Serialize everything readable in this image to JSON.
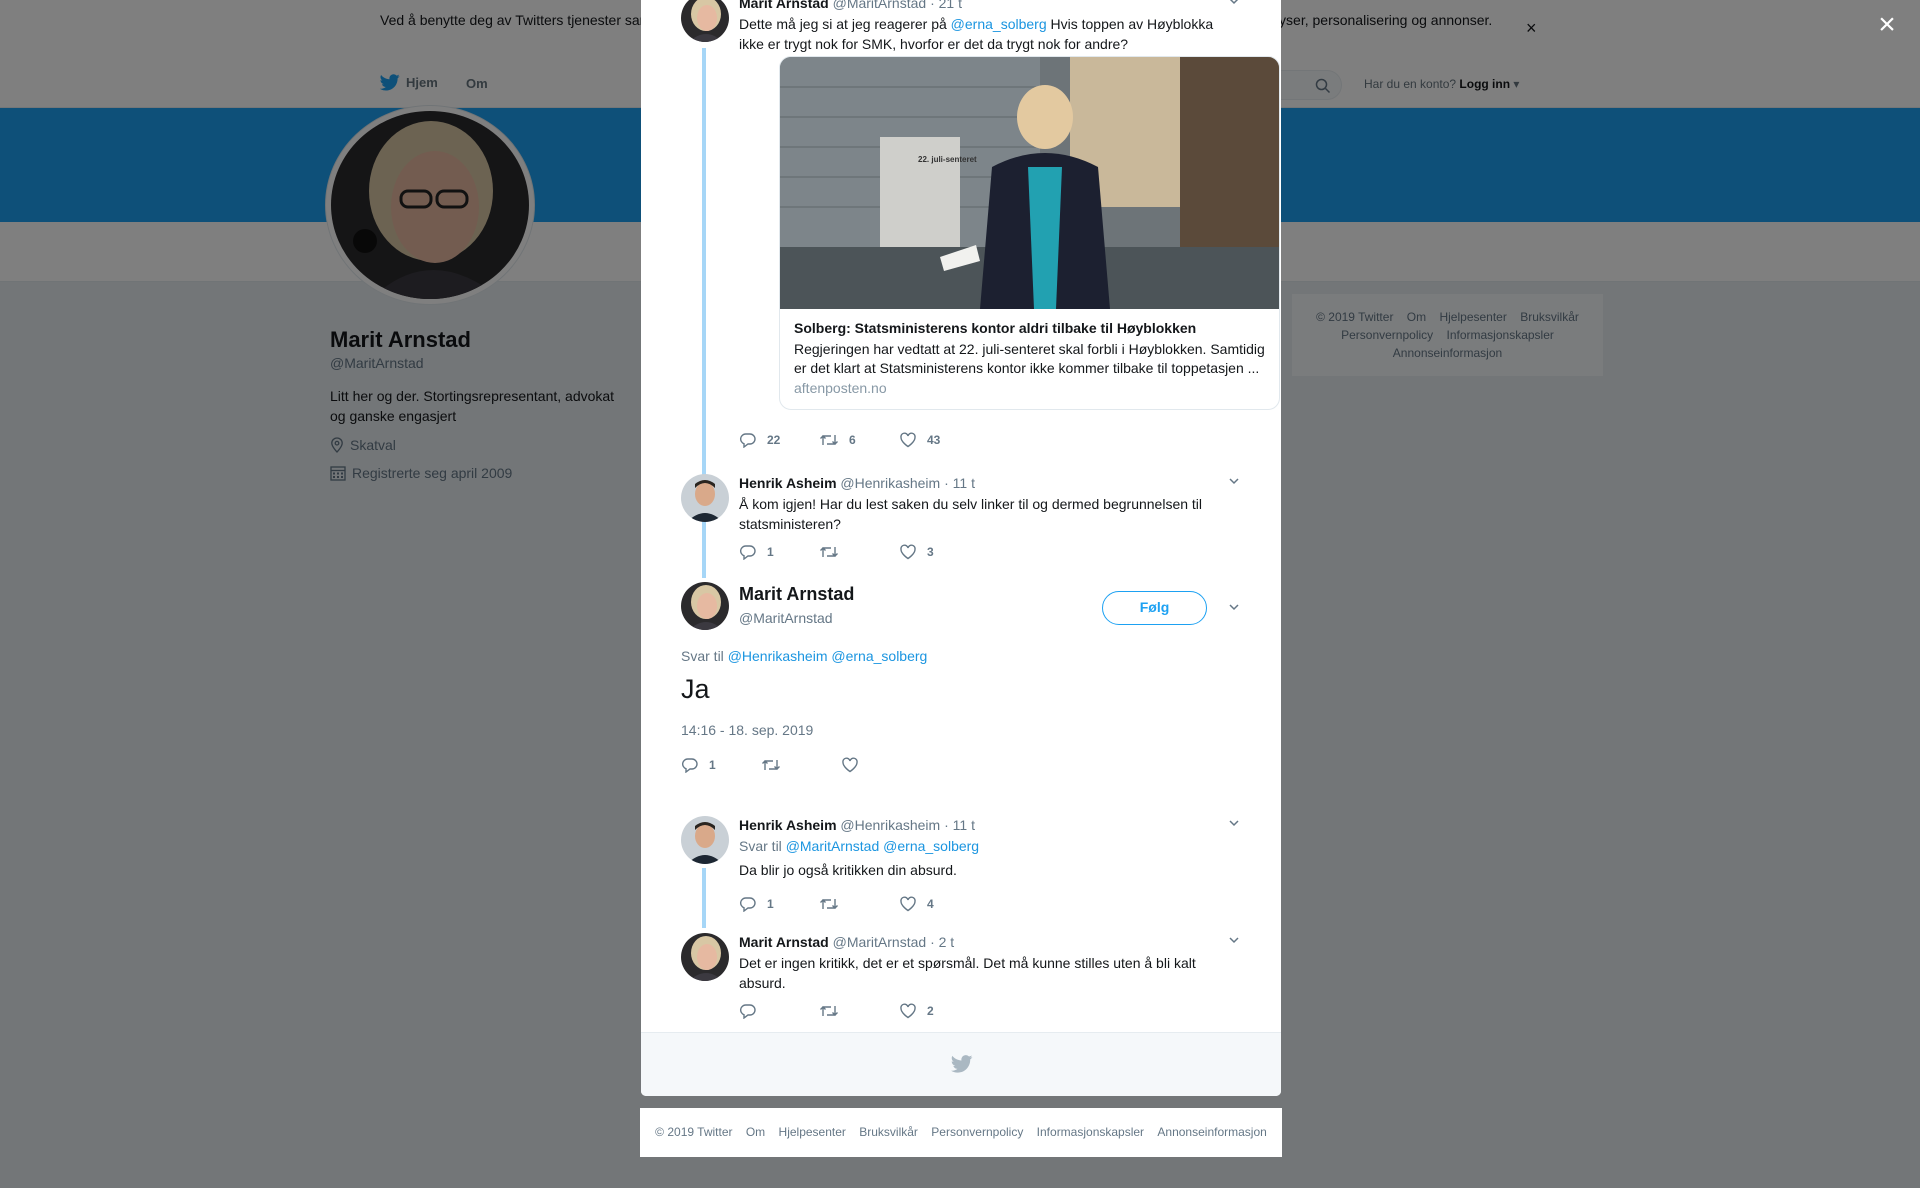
{
  "cookie_banner": {
    "text": "Ved å benytte deg av Twitters tjenester samtykker du i bruken av informasjonskapsler. Twitter og partnere bruker informasjonskapsler til bl.a. analyser, personalisering og annonser.",
    "close_symbol": "×"
  },
  "nav": {
    "home": "Hjem",
    "about": "Om",
    "account_prompt": "Har du en konto?",
    "login": "Logg inn"
  },
  "profile": {
    "name": "Marit Arnstad",
    "handle": "@MaritArnstad",
    "bio": "Litt her og der. Stortingsrepresentant, advokat og ganske engasjert",
    "location": "Skatval",
    "joined": "Registrerte seg april 2009"
  },
  "side_footer": [
    "© 2019 Twitter",
    "Om",
    "Hjelpesenter",
    "Bruksvilkår",
    "Personvernpolicy",
    "Informasjonskapsler",
    "Annonseinformasjon"
  ],
  "overlay_close": "×",
  "tweets": {
    "first": {
      "name": "Marit Arnstad",
      "handle": "@MaritArnstad",
      "time": "· 21 t",
      "text_before": "Dette må jeg si at jeg reagerer på ",
      "mention": "@erna_solberg",
      "text_after": " Hvis toppen av Høyblokka ikke er trygt nok for SMK, hvorfor er det da trygt nok for andre?",
      "card": {
        "image_caption": "22. juli-senteret",
        "title": "Solberg: Statsministerens kontor aldri tilbake til Høyblokken",
        "description": "Regjeringen har vedtatt at 22. juli-senteret skal forbli i Høyblokken. Samtidig er det klart at Statsministerens kontor ikke kommer tilbake til toppetasjen ...",
        "domain": "aftenposten.no"
      },
      "replies": "22",
      "retweets": "6",
      "likes": "43"
    },
    "second": {
      "name": "Henrik Asheim",
      "handle": "@Henrikasheim",
      "time": "· 11 t",
      "text": "Å kom igjen! Har du lest saken du selv linker til og dermed begrunnelsen til statsministeren?",
      "replies": "1",
      "retweets": "",
      "likes": "3"
    },
    "main": {
      "name": "Marit Arnstad",
      "handle": "@MaritArnstad",
      "follow": "Følg",
      "reply_prefix": "Svar til",
      "mention1": "@Henrikasheim",
      "mention2": "@erna_solberg",
      "text": "Ja",
      "timestamp": "14:16 - 18. sep. 2019",
      "replies": "1"
    },
    "fourth": {
      "name": "Henrik Asheim",
      "handle": "@Henrikasheim",
      "time": "· 11 t",
      "reply_prefix": "Svar til",
      "mention1": "@MaritArnstad",
      "mention2": "@erna_solberg",
      "text": "Da blir jo også kritikken din absurd.",
      "replies": "1",
      "likes": "4"
    },
    "fifth": {
      "name": "Marit Arnstad",
      "handle": "@MaritArnstad",
      "time": "· 2 t",
      "text": "Det er ingen kritikk, det er et spørsmål. Det må kunne stilles uten å bli kalt absurd.",
      "likes": "2"
    }
  },
  "modal_footer": [
    "© 2019 Twitter",
    "Om",
    "Hjelpesenter",
    "Bruksvilkår",
    "Personvernpolicy",
    "Informasjonskapsler",
    "Annonseinformasjon"
  ],
  "colors": {
    "twitter_blue": "#1da1f2",
    "link": "#1b95e0",
    "thread_line": "#a6d6f7",
    "muted": "#657786",
    "page_bg": "#e6ecf0"
  }
}
